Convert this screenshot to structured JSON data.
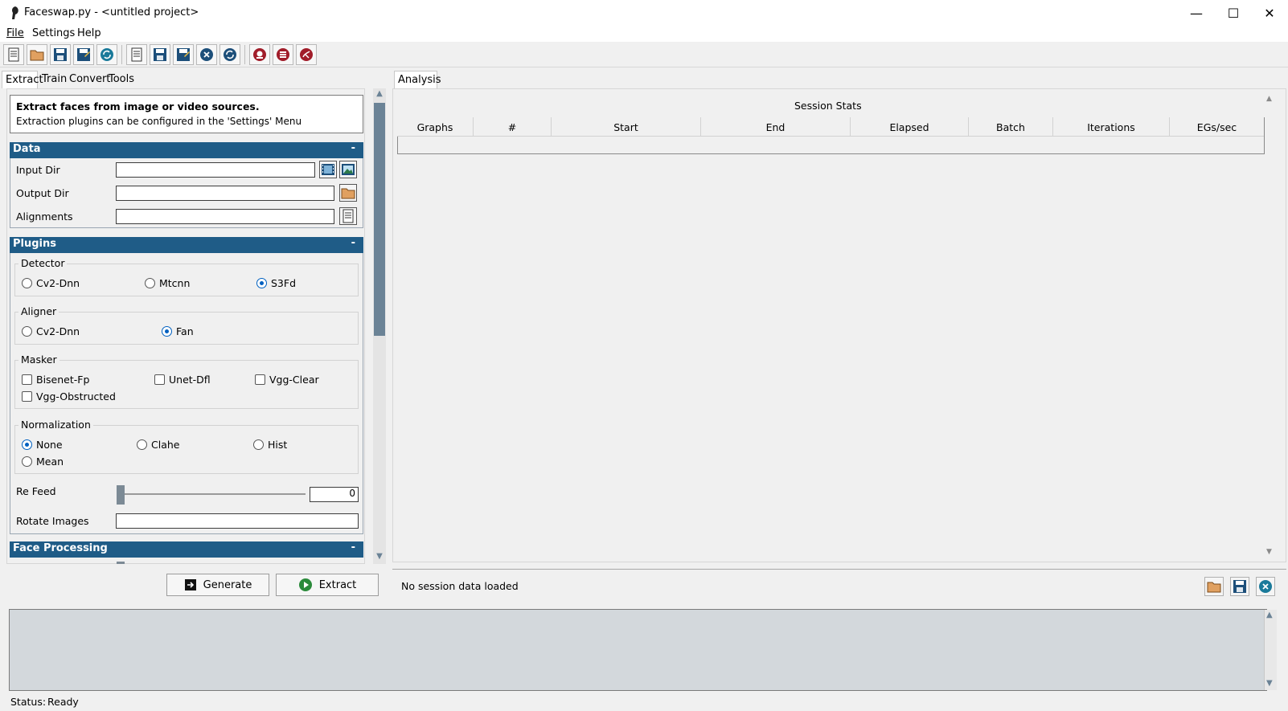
{
  "window": {
    "title": "Faceswap.py - <untitled project>",
    "minimize_glyph": "—",
    "maximize_glyph": "☐",
    "close_glyph": "✕"
  },
  "menu": {
    "file": "File",
    "settings": "Settings",
    "help": "Help"
  },
  "toolbar": {
    "icons": [
      "new-project-icon",
      "open-project-icon",
      "save-project-icon",
      "save-as-project-icon",
      "reload-project-icon",
      "new-task-icon",
      "save-task-icon",
      "save-as-task-icon",
      "clear-task-icon",
      "reload-task-icon",
      "patreon-icon",
      "discord-icon",
      "github-icon"
    ]
  },
  "left_tabs": [
    "Extract",
    "Train",
    "Convert",
    "Tools"
  ],
  "info": {
    "title": "Extract faces from image or video sources.",
    "body": "Extraction plugins can be configured in the 'Settings' Menu"
  },
  "data_section": {
    "header": "Data",
    "collapse": "-",
    "input_dir_label": "Input Dir",
    "output_dir_label": "Output Dir",
    "alignments_label": "Alignments",
    "input_dir_value": "",
    "output_dir_value": "",
    "alignments_value": ""
  },
  "plugins_section": {
    "header": "Plugins",
    "collapse": "-",
    "detector": {
      "title": "Detector",
      "options": [
        "Cv2-Dnn",
        "Mtcnn",
        "S3Fd"
      ],
      "selected": "S3Fd"
    },
    "aligner": {
      "title": "Aligner",
      "options": [
        "Cv2-Dnn",
        "Fan"
      ],
      "selected": "Fan"
    },
    "masker": {
      "title": "Masker",
      "options": [
        "Bisenet-Fp",
        "Unet-Dfl",
        "Vgg-Clear",
        "Vgg-Obstructed"
      ],
      "checked": []
    },
    "normalization": {
      "title": "Normalization",
      "options": [
        "None",
        "Clahe",
        "Hist",
        "Mean"
      ],
      "selected": "None"
    },
    "re_feed_label": "Re Feed",
    "re_feed_value": "0",
    "rotate_images_label": "Rotate Images",
    "rotate_images_value": ""
  },
  "face_processing": {
    "header": "Face Processing",
    "collapse": "-"
  },
  "buttons": {
    "generate": "Generate",
    "extract": "Extract"
  },
  "analysis": {
    "tab": "Analysis",
    "title": "Session Stats",
    "columns": [
      "Graphs",
      "#",
      "Start",
      "End",
      "Elapsed",
      "Batch",
      "Iterations",
      "EGs/sec"
    ],
    "status": "No session data loaded"
  },
  "status_bar": {
    "label": "Status:",
    "value": "Ready"
  },
  "colors": {
    "section_header": "#1f5c87",
    "radio_selected": "#0060c0",
    "console_bg": "#d3d8dc"
  }
}
